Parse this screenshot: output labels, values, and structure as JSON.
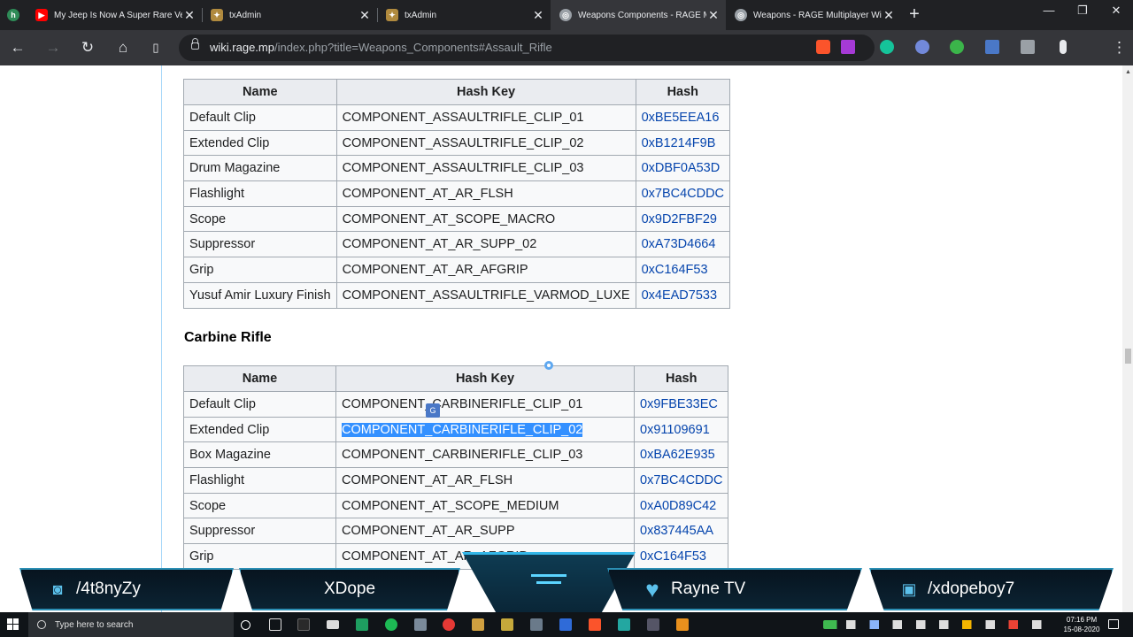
{
  "browser": {
    "tabs": [
      {
        "title": "My Jeep Is Now A Super Rare Vehicle",
        "icon": "youtube-icon",
        "active": false
      },
      {
        "title": "txAdmin",
        "icon": "txadmin-icon",
        "active": false
      },
      {
        "title": "txAdmin",
        "icon": "txadmin-icon",
        "active": false
      },
      {
        "title": "Weapons Components - RAGE Multiplayer Wiki",
        "icon": "globe-icon",
        "active": true
      },
      {
        "title": "Weapons - RAGE Multiplayer Wiki",
        "icon": "globe-icon",
        "active": false
      }
    ],
    "close_glyph": "✕",
    "new_tab_glyph": "+",
    "url_host": "wiki.rage.mp",
    "url_path": "/index.php?title=Weapons_Components#Assault_Rifle"
  },
  "assault_table": {
    "headers": [
      "Name",
      "Hash Key",
      "Hash"
    ],
    "rows": [
      [
        "Default Clip",
        "COMPONENT_ASSAULTRIFLE_CLIP_01",
        "0xBE5EEA16"
      ],
      [
        "Extended Clip",
        "COMPONENT_ASSAULTRIFLE_CLIP_02",
        "0xB1214F9B"
      ],
      [
        "Drum Magazine",
        "COMPONENT_ASSAULTRIFLE_CLIP_03",
        "0xDBF0A53D"
      ],
      [
        "Flashlight",
        "COMPONENT_AT_AR_FLSH",
        "0x7BC4CDDC"
      ],
      [
        "Scope",
        "COMPONENT_AT_SCOPE_MACRO",
        "0x9D2FBF29"
      ],
      [
        "Suppressor",
        "COMPONENT_AT_AR_SUPP_02",
        "0xA73D4664"
      ],
      [
        "Grip",
        "COMPONENT_AT_AR_AFGRIP",
        "0xC164F53"
      ],
      [
        "Yusuf Amir Luxury Finish",
        "COMPONENT_ASSAULTRIFLE_VARMOD_LUXE",
        "0x4EAD7533"
      ]
    ]
  },
  "carbine_section": {
    "heading": "Carbine Rifle",
    "headers": [
      "Name",
      "Hash Key",
      "Hash"
    ],
    "rows": [
      [
        "Default Clip",
        "COMPONENT_CARBINERIFLE_CLIP_01",
        "0x9FBE33EC"
      ],
      [
        "Extended Clip",
        "COMPONENT_CARBINERIFLE_CLIP_02",
        "0x91109691"
      ],
      [
        "Box Magazine",
        "COMPONENT_CARBINERIFLE_CLIP_03",
        "0xBA62E935"
      ],
      [
        "Flashlight",
        "COMPONENT_AT_AR_FLSH",
        "0x7BC4CDDC"
      ],
      [
        "Scope",
        "COMPONENT_AT_SCOPE_MEDIUM",
        "0xA0D89C42"
      ],
      [
        "Suppressor",
        "COMPONENT_AT_AR_SUPP",
        "0x837445AA"
      ],
      [
        "Grip",
        "COMPONENT_AT_AR_AFGRIP",
        "0xC164F53"
      ]
    ],
    "selected_row": 1
  },
  "overlay": {
    "discord": "/4t8nyZy",
    "name1": "XDope",
    "name2": "Rayne TV",
    "twitch": "/xdopeboy7"
  },
  "taskbar": {
    "search_placeholder": "Type here to search",
    "time": "07:16 PM",
    "date": "15-08-2020"
  },
  "colors": {
    "link": "#0645ad",
    "selection": "#3390ff",
    "overlay_accent": "#2b8fb5"
  }
}
